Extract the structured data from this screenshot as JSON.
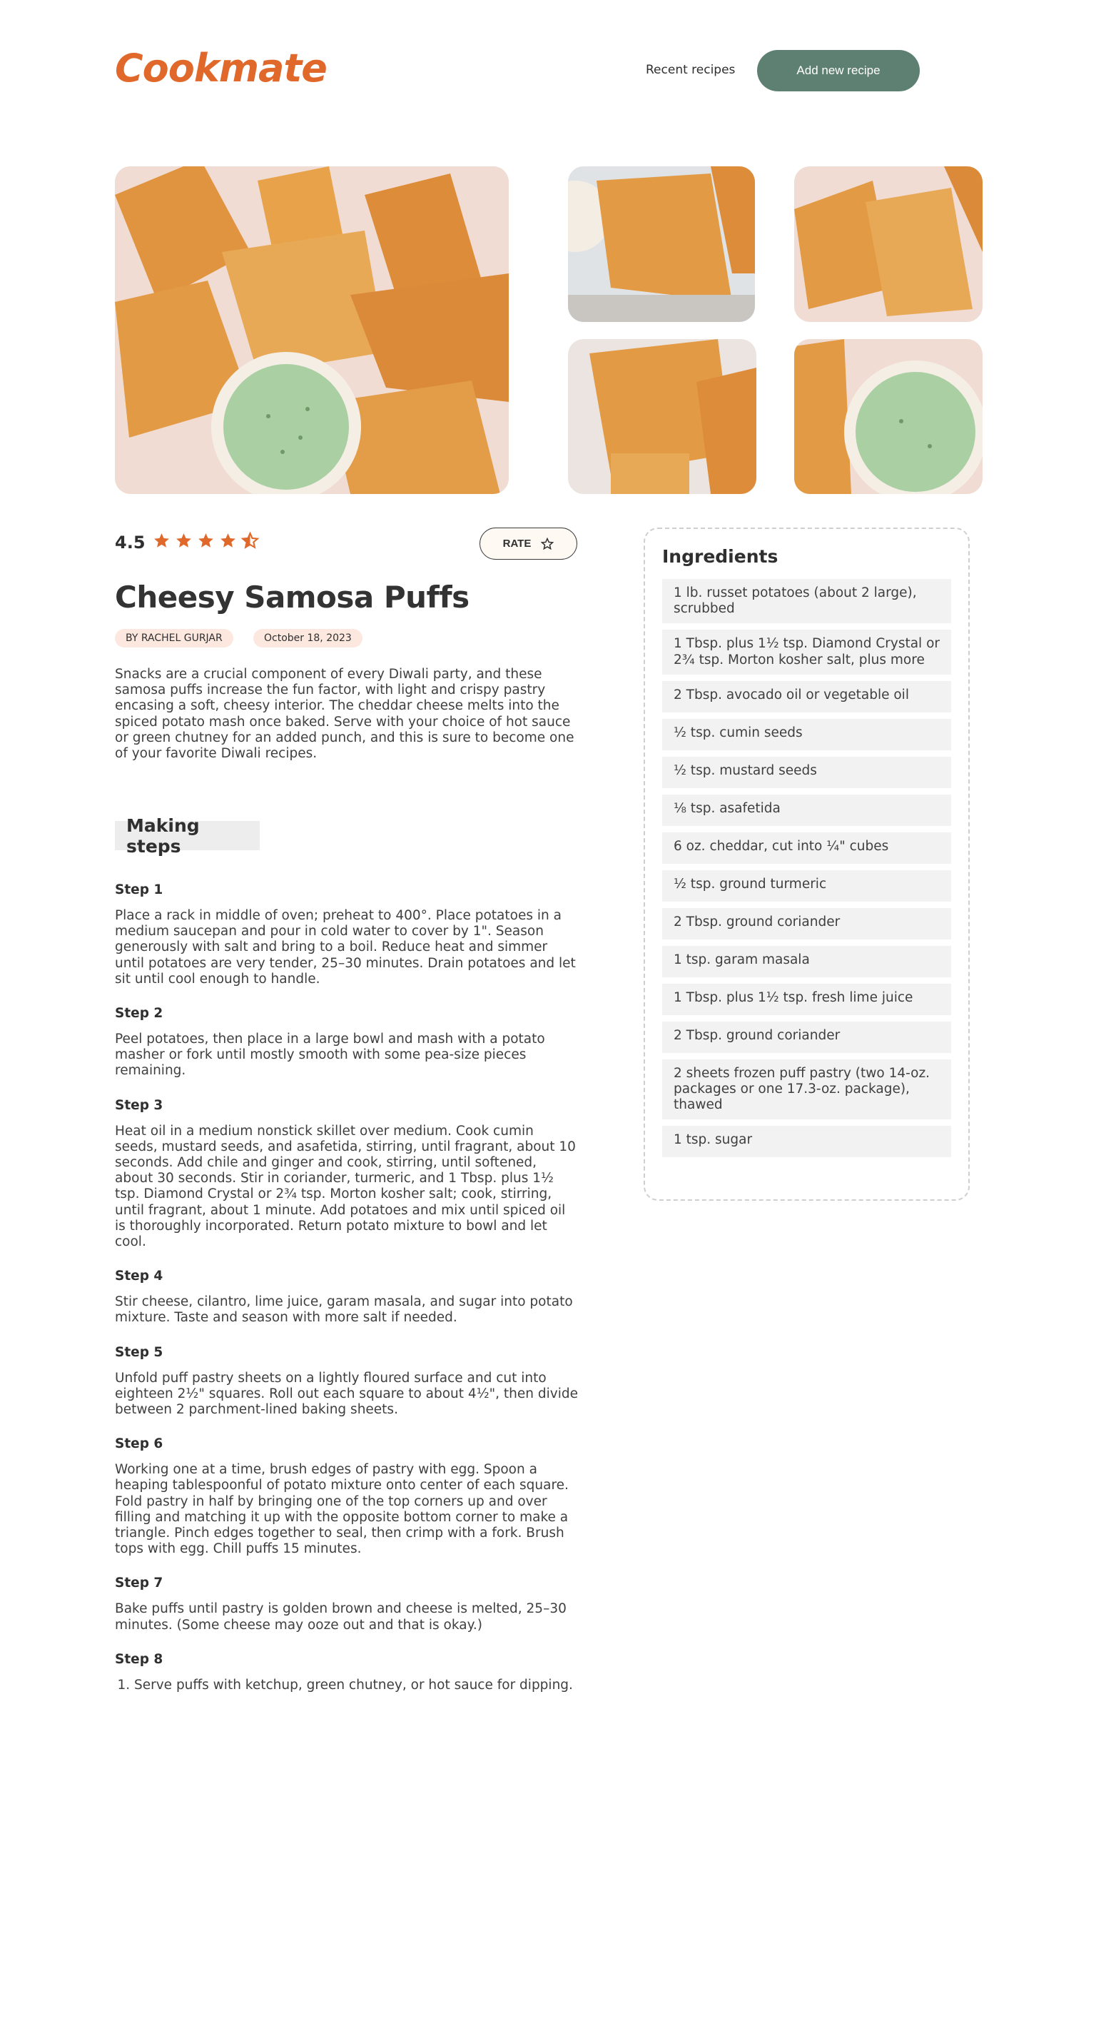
{
  "header": {
    "logo": "Cookmate",
    "nav_recent": "Recent recipes",
    "add_button": "Add new recipe"
  },
  "colors": {
    "brand_orange": "#e0682a",
    "button_green": "#5e8073",
    "badge_bg": "#fde8df",
    "panel_gray": "#f2f2f2"
  },
  "recipe": {
    "rating": "4.5",
    "rating_value": 4.5,
    "rating_max": 5,
    "rate_button": "RATE",
    "title": "Cheesy Samosa Puffs",
    "author": "BY RACHEL GURJAR",
    "date": "October 18, 2023",
    "description": "Snacks are a crucial component of every Diwali party, and these samosa puffs increase the fun factor, with light and crispy pastry encasing a soft, cheesy interior. The cheddar cheese melts into the spiced potato mash once baked. Serve with your choice of hot sauce or green chutney for an added punch, and this is sure to become one of your favorite Diwali recipes."
  },
  "steps_heading": "Making steps",
  "steps": [
    {
      "title": "Step 1",
      "text": "Place a rack in middle of oven; preheat to 400°. Place potatoes in a medium saucepan and pour in cold water to cover by 1\". Season generously with salt and bring to a boil. Reduce heat and simmer until potatoes are very tender, 25–30 minutes. Drain potatoes and let sit until cool enough to handle."
    },
    {
      "title": "Step 2",
      "text": "Peel potatoes, then place in a large bowl and mash with a potato masher or fork until mostly smooth with some pea-size pieces remaining."
    },
    {
      "title": "Step 3",
      "text": "Heat oil in a medium nonstick skillet over medium. Cook cumin seeds, mustard seeds, and asafetida, stirring, until fragrant, about 10 seconds. Add chile and ginger and cook, stirring, until softened, about 30 seconds. Stir in coriander, turmeric, and 1 Tbsp. plus 1½ tsp. Diamond Crystal or 2¾ tsp. Morton kosher salt; cook, stirring, until fragrant, about 1 minute. Add potatoes and mix until spiced oil is thoroughly incorporated. Return potato mixture to bowl and let cool."
    },
    {
      "title": "Step 4",
      "text": "Stir cheese, cilantro, lime juice, garam masala, and sugar into potato mixture. Taste and season with more salt if needed."
    },
    {
      "title": "Step 5",
      "text": "Unfold puff pastry sheets on a lightly floured surface and cut into eighteen 2½\" squares. Roll out each square to about 4½\", then divide between 2 parchment-lined baking sheets."
    },
    {
      "title": "Step 6",
      "text": "Working one at a time, brush edges of pastry with egg. Spoon a heaping tablespoonful of potato mixture onto center of each square. Fold pastry in half by bringing one of the top corners up and over filling and matching it up with the opposite bottom corner to make a triangle. Pinch edges together to seal, then crimp with a fork. Brush tops with egg. Chill puffs 15 minutes."
    },
    {
      "title": "Step 7",
      "text": "Bake puffs until pastry is golden brown and cheese is melted, 25–30 minutes. (Some cheese may ooze out and that is okay.)"
    },
    {
      "title": "Step 8",
      "list": [
        "Serve puffs with ketchup, green chutney, or hot sauce for dipping."
      ]
    }
  ],
  "ingredients_heading": "Ingredients",
  "ingredients": [
    "1 lb. russet potatoes (about 2 large), scrubbed",
    "1 Tbsp. plus 1½ tsp. Diamond Crystal or 2¾ tsp. Morton kosher salt, plus more",
    "2 Tbsp. avocado oil or vegetable oil",
    "½ tsp. cumin seeds",
    "½ tsp. mustard seeds",
    "⅛ tsp. asafetida",
    "6 oz. cheddar, cut into ¼\" cubes",
    "½ tsp. ground turmeric",
    "2 Tbsp. ground coriander",
    "1 tsp. garam masala",
    "1 Tbsp. plus 1½ tsp. fresh lime juice",
    "2 Tbsp. ground coriander",
    "2 sheets frozen puff pastry (two 14-oz. packages or one 17.3-oz. package), thawed",
    "1 tsp. sugar"
  ]
}
